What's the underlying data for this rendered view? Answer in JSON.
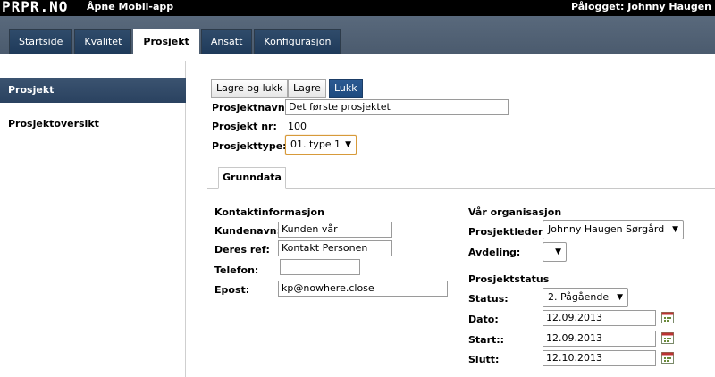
{
  "header": {
    "logo": "PRPR.NO",
    "app_name": "Åpne Mobil-app",
    "user": "Pålogget: Johnny Haugen"
  },
  "tabs": [
    "Startside",
    "Kvalitet",
    "Prosjekt",
    "Ansatt",
    "Konfigurasjon"
  ],
  "active_tab": "Prosjekt",
  "sidebar": {
    "active": "Prosjekt",
    "items": [
      "Prosjektoversikt"
    ]
  },
  "toolbar": {
    "save_close": "Lagre og lukk",
    "save": "Lagre",
    "close": "Lukk"
  },
  "project": {
    "name_label": "Prosjektnavn:",
    "name_value": "Det første prosjektet",
    "nr_label": "Prosjekt nr:",
    "nr_value": "100",
    "type_label": "Prosjekttype:",
    "type_value": "01. type 1"
  },
  "subtab": "Grunndata",
  "contact": {
    "title": "Kontaktinformasjon",
    "customer_label": "Kundenavn:",
    "customer_value": "Kunden vår",
    "ref_label": "Deres ref:",
    "ref_value": "Kontakt Personen",
    "phone_label": "Telefon:",
    "phone_value": "",
    "email_label": "Epost:",
    "email_value": "kp@nowhere.close"
  },
  "org": {
    "title": "Vår organisasjon",
    "leader_label": "Prosjektleder:",
    "leader_value": "Johnny Haugen Sørgård",
    "dept_label": "Avdeling:",
    "dept_value": ""
  },
  "status": {
    "title": "Prosjektstatus",
    "status_label": "Status:",
    "status_value": "2. Pågående",
    "date_label": "Dato:",
    "date_value": "12.09.2013",
    "start_label": "Start::",
    "start_value": "12.09.2013",
    "end_label": "Slutt:",
    "end_value": "12.10.2013"
  }
}
